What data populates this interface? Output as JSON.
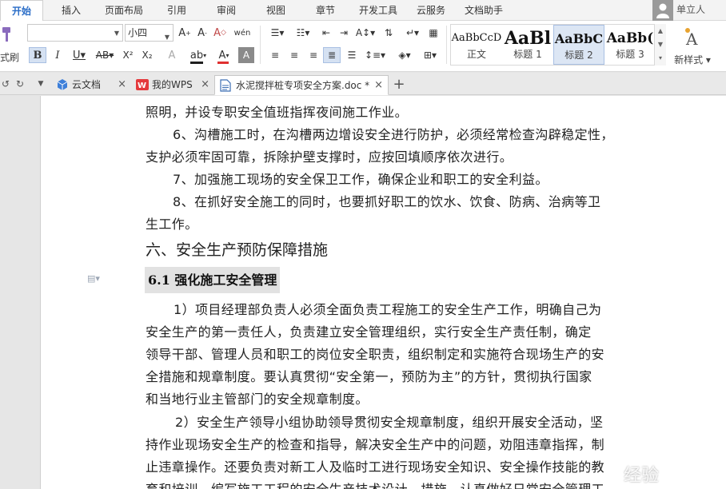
{
  "menu": {
    "tabs": [
      "开始",
      "插入",
      "页面布局",
      "引用",
      "审阅",
      "视图",
      "章节",
      "开发工具",
      "云服务",
      "文档助手"
    ],
    "user": "单立人"
  },
  "ribbon": {
    "clipboard_label": "式刷",
    "font_name": "",
    "font_size": "小四",
    "styles": [
      {
        "sample": "AaBbCcD",
        "label": "正文"
      },
      {
        "sample": "AaBl",
        "label": "标题 1"
      },
      {
        "sample": "AaBbC",
        "label": "标题 2"
      },
      {
        "sample": "AaBb(",
        "label": "标题 3"
      }
    ],
    "new_style_label": "新样式",
    "accent_color": "#2a6dc7",
    "font_color_bar": "#e03030",
    "highlight_color_bar": "#1f1f1f"
  },
  "tabstrip": {
    "tabs": [
      {
        "label": "云文档"
      },
      {
        "label": "我的WPS"
      },
      {
        "label": "水泥搅拌桩专项安全方案.doc *"
      }
    ],
    "add": "+"
  },
  "document": {
    "lines": [
      "照明，并设专职安全值班指挥夜间施工作业。",
      "6、沟槽施工时，在沟槽两边增设安全进行防护，必须经常检查沟辟稳定性，",
      "支护必须牢固可靠，拆除护壁支撑时，应按回填顺序依次进行。",
      "7、加强施工现场的安全保卫工作，确保企业和职工的安全利益。",
      "8、在抓好安全施工的同时，也要抓好职工的饮水、饮食、防病、治病等卫",
      "生工作。",
      "六、安全生产预防保障措施",
      "6.1 强化施工安全管理",
      "1）项目经理部负责人必须全面负责工程施工的安全生产工作，明确自己为",
      "安全生产的第一责任人，负责建立安全管理组织，实行安全生产责任制，确定",
      "领导干部、管理人员和职工的岗位安全职责，组织制定和实施符合现场生产的安",
      "全措施和规章制度。要认真贯彻“安全第一，预防为主”的方针，贯彻执行国家",
      "和当地行业主管部门的安全规章制度。",
      "2）安全生产领导小组协助领导贯彻安全规章制度，组织开展安全活动，坚",
      "持作业现场安全生产的检查和指导，解决安全生产中的问题，劝阻违章指挥，制",
      "止违章操作。还要负责对新工人及临时工进行现场安全知识、安全操作技能的教",
      "育和培训，编写施工工程的安全生产技术设计、措施，认真做好日常安全管理工"
    ]
  },
  "watermark": "经验"
}
